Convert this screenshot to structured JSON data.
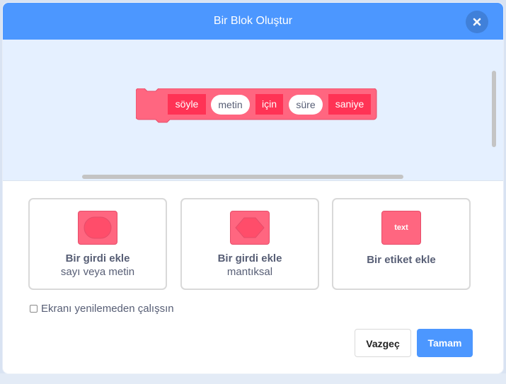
{
  "dialog": {
    "title": "Bir Blok Oluştur",
    "close_icon": "close-icon"
  },
  "block": {
    "color": "#ff6680",
    "segments": [
      "söyle",
      "metin",
      "için",
      "süre",
      "saniye"
    ]
  },
  "options": [
    {
      "title": "Bir girdi ekle",
      "subtitle": "sayı veya metin",
      "icon": "round-input-icon"
    },
    {
      "title": "Bir girdi ekle",
      "subtitle": "mantıksal",
      "icon": "boolean-input-icon"
    },
    {
      "title": "Bir etiket ekle",
      "icon": "label-icon",
      "icon_text": "text"
    }
  ],
  "run_without_refresh": {
    "label": "Ekranı yenilemeden çalışsın",
    "checked": false
  },
  "buttons": {
    "cancel": "Vazgeç",
    "ok": "Tamam"
  },
  "colors": {
    "header": "#4c97ff",
    "block_fill": "#ff6680",
    "block_label": "#ff3355",
    "workspace": "#e5f0ff"
  }
}
